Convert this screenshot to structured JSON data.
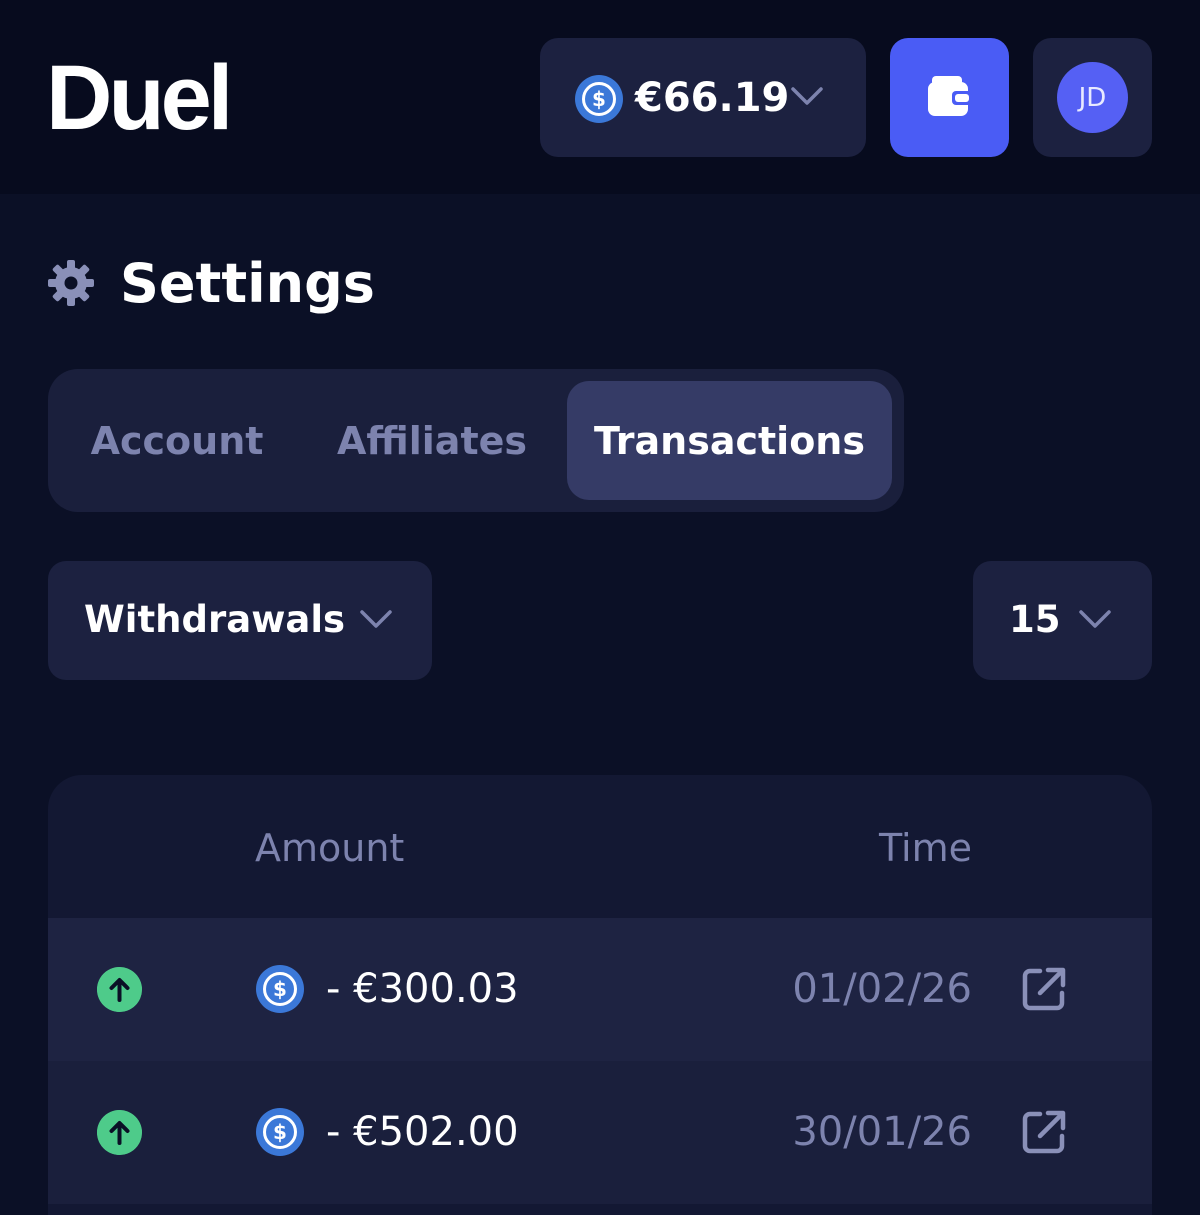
{
  "header": {
    "logo": "Duel",
    "balance": {
      "value": "€66.19",
      "currency_icon": "usdc-coin-icon"
    },
    "wallet_icon": "wallet-icon",
    "avatar_initials": "JD"
  },
  "page": {
    "title": "Settings",
    "icon": "gear-icon"
  },
  "tabs": [
    {
      "label": "Account",
      "active": false
    },
    {
      "label": "Affiliates",
      "active": false
    },
    {
      "label": "Transactions",
      "active": true
    }
  ],
  "filters": {
    "type_selected": "Withdrawals",
    "per_page_selected": "15"
  },
  "table": {
    "columns": [
      "Amount",
      "Time"
    ],
    "rows": [
      {
        "direction_icon": "arrow-up-icon",
        "amount": "- €300.03",
        "time": "01/02/26",
        "link_icon": "external-link-icon"
      },
      {
        "direction_icon": "arrow-up-icon",
        "amount": "- €502.00",
        "time": "30/01/26",
        "link_icon": "external-link-icon"
      }
    ]
  },
  "colors": {
    "background": "#0b1026",
    "accent": "#4a5cf5",
    "positive": "#4ecb8a",
    "muted_text": "#7d83ae"
  }
}
